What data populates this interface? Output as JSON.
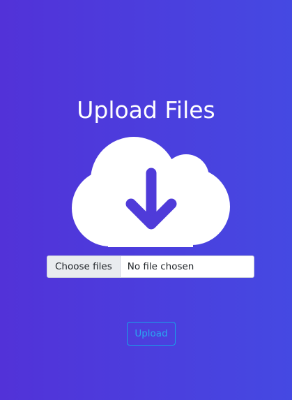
{
  "page": {
    "title": "Upload Files",
    "background_gradient": [
      "#5232d8",
      "#4549e2"
    ]
  },
  "upload_illustration": {
    "icon": "cloud-download-icon",
    "fill_color": "#ffffff",
    "arrow_color": "#4f3bd9"
  },
  "file_input": {
    "button_label": "Choose files",
    "status_text": "No file chosen"
  },
  "actions": {
    "upload_label": "Upload",
    "upload_color": "#17a2e8"
  }
}
